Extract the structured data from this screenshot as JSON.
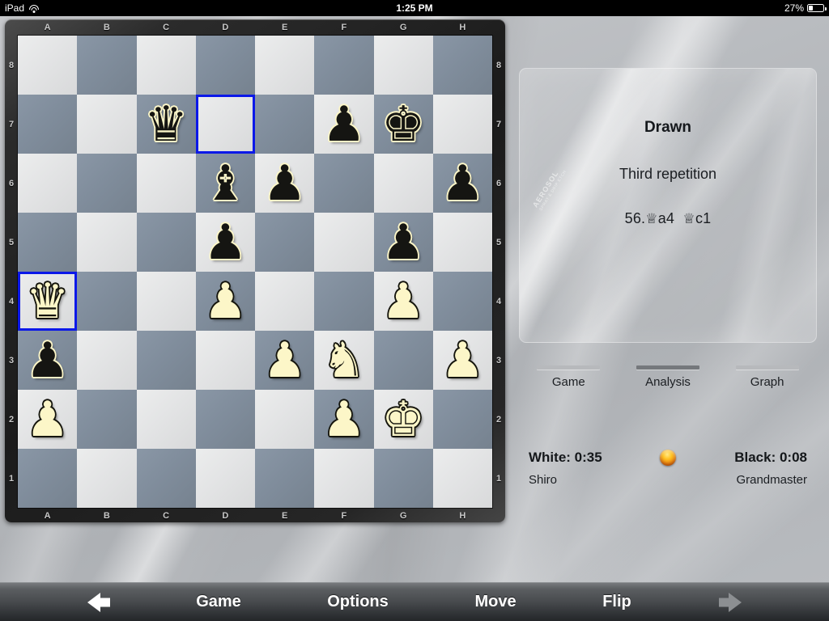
{
  "status_bar": {
    "carrier": "iPad",
    "wifi_icon": "wifi-icon",
    "time": "1:25 PM",
    "battery_percent": "27%",
    "battery_icon": "battery-icon"
  },
  "board": {
    "files": [
      "A",
      "B",
      "C",
      "D",
      "E",
      "F",
      "G",
      "H"
    ],
    "ranks": [
      "8",
      "7",
      "6",
      "5",
      "4",
      "3",
      "2",
      "1"
    ],
    "light_square_color": "#e3e4e5",
    "dark_square_color": "#808d9c",
    "highlight_color": "#0b18e8",
    "orientation": "white-bottom",
    "highlighted_squares": [
      "d7",
      "a4"
    ],
    "pieces": [
      {
        "square": "c7",
        "color": "black",
        "type": "queen",
        "glyph": "♛"
      },
      {
        "square": "f7",
        "color": "black",
        "type": "pawn",
        "glyph": "♟"
      },
      {
        "square": "g7",
        "color": "black",
        "type": "king",
        "glyph": "♚"
      },
      {
        "square": "d6",
        "color": "black",
        "type": "bishop",
        "glyph": "♝"
      },
      {
        "square": "e6",
        "color": "black",
        "type": "pawn",
        "glyph": "♟"
      },
      {
        "square": "h6",
        "color": "black",
        "type": "pawn",
        "glyph": "♟"
      },
      {
        "square": "d5",
        "color": "black",
        "type": "pawn",
        "glyph": "♟"
      },
      {
        "square": "g5",
        "color": "black",
        "type": "pawn",
        "glyph": "♟"
      },
      {
        "square": "a4",
        "color": "white",
        "type": "queen",
        "glyph": "♛"
      },
      {
        "square": "d4",
        "color": "white",
        "type": "pawn",
        "glyph": "♟"
      },
      {
        "square": "g4",
        "color": "white",
        "type": "pawn",
        "glyph": "♟"
      },
      {
        "square": "a3",
        "color": "black",
        "type": "pawn",
        "glyph": "♟"
      },
      {
        "square": "e3",
        "color": "white",
        "type": "pawn",
        "glyph": "♟"
      },
      {
        "square": "f3",
        "color": "white",
        "type": "knight",
        "glyph": "♞"
      },
      {
        "square": "h3",
        "color": "white",
        "type": "pawn",
        "glyph": "♟"
      },
      {
        "square": "a2",
        "color": "white",
        "type": "pawn",
        "glyph": "♟"
      },
      {
        "square": "f2",
        "color": "white",
        "type": "pawn",
        "glyph": "♟"
      },
      {
        "square": "g2",
        "color": "white",
        "type": "king",
        "glyph": "♚"
      }
    ]
  },
  "info_panel": {
    "result": "Drawn",
    "reason": "Third repetition",
    "move_number": "56.",
    "white_move": "a4",
    "black_move": "c1",
    "queen_glyph": "♕",
    "move_full": "56.♕a4 ♕c1",
    "watermark": "AEROSOL",
    "watermark_sub": "SPRAY & DRIP ETCH"
  },
  "tabs": [
    {
      "label": "Game",
      "active": false
    },
    {
      "label": "Analysis",
      "active": true
    },
    {
      "label": "Graph",
      "active": false
    }
  ],
  "clocks": {
    "white_label": "White: 0:35",
    "white_name": "Shiro",
    "black_label": "Black: 0:08",
    "black_name": "Grandmaster",
    "turn_indicator": "turn-led-icon",
    "turn_indicator_color": "#ffc324"
  },
  "toolbar": {
    "back_arrow": "arrow-left-icon",
    "items": [
      "Game",
      "Options",
      "Move",
      "Flip"
    ],
    "forward_arrow": "arrow-right-icon",
    "back_enabled": true,
    "forward_enabled": false
  }
}
